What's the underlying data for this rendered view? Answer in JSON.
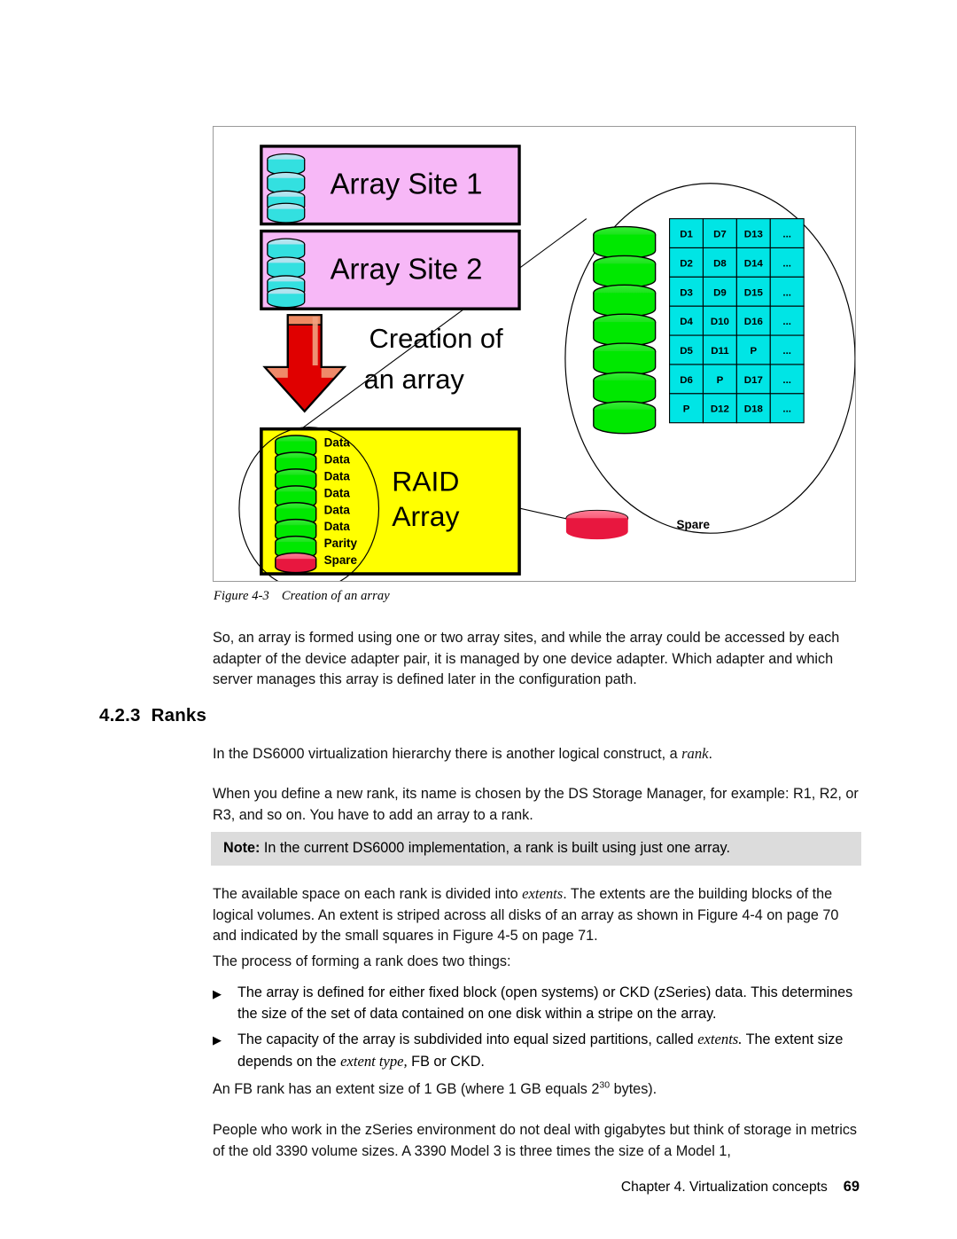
{
  "figure": {
    "caption_number": "Figure 4-3",
    "caption_text": "Creation of an array",
    "array_site_1": "Array Site 1",
    "array_site_2": "Array Site 2",
    "creation_label_line1": "Creation of",
    "creation_label_line2": "an array",
    "raid_label_line1": "RAID",
    "raid_label_line2": "Array",
    "disk_labels": [
      "Data",
      "Data",
      "Data",
      "Data",
      "Data",
      "Data",
      "Parity",
      "Spare"
    ],
    "spare_label": "Spare",
    "grid": {
      "rows": [
        [
          "D1",
          "D7",
          "D13",
          "..."
        ],
        [
          "D2",
          "D8",
          "D14",
          "..."
        ],
        [
          "D3",
          "D9",
          "D15",
          "..."
        ],
        [
          "D4",
          "D10",
          "D16",
          "..."
        ],
        [
          "D5",
          "D11",
          "P",
          "..."
        ],
        [
          "D6",
          "P",
          "D17",
          "..."
        ],
        [
          "P",
          "D12",
          "D18",
          "..."
        ]
      ]
    },
    "colors": {
      "array_site_fill": "#f7b8f7",
      "raid_fill": "#ffff00",
      "disk_cyan": "#33e0e0",
      "disk_green": "#00e800",
      "disk_red": "#e8173f",
      "grid_fill": "#00e5e5",
      "arrow_red": "#e00000",
      "frame_border": "#9a9a9a"
    }
  },
  "paragraphs": {
    "p1": "So, an array is formed using one or two array sites, and while the array could be accessed by each adapter of the device adapter pair, it is managed by one device adapter. Which adapter and which server manages this array is defined later in the configuration path.",
    "p2_pre": "In the DS6000 virtualization hierarchy there is another logical construct, a ",
    "p2_ital": "rank",
    "p2_post": ".",
    "p3": "When you define a new rank, its name is chosen by the DS Storage Manager, for example: R1, R2, or R3, and so on. You have to add an array to a rank.",
    "p4_pre": "The available space on each rank is divided into ",
    "p4_ital": "extents",
    "p4_post": ". The extents are the building blocks of the logical volumes. An extent is striped across all disks of an array as shown in Figure 4-4 on page 70 and indicated by the small squares in Figure 4-5 on page 71.",
    "p5": "The process of forming a rank does two things:",
    "p6_pre": "An FB rank has an extent size of 1 GB (where 1 GB equals 2",
    "p6_exp": "30",
    "p6_post": " bytes).",
    "p7": "People who work in the zSeries environment do not deal with gigabytes but think of storage in metrics of the old 3390 volume sizes. A 3390 Model 3 is three times the size of a Model 1,"
  },
  "heading": {
    "number": "4.2.3",
    "title": "Ranks"
  },
  "note": {
    "label": "Note:",
    "text": " In the current DS6000 implementation, a rank is built using just one array."
  },
  "bullets": [
    {
      "marker": "▶",
      "pre": "The array is defined for either fixed block (open systems) or CKD (zSeries) data. This determines the size of the set of data contained on one disk within a stripe on the array.",
      "ital": "",
      "post": ""
    },
    {
      "marker": "▶",
      "pre": "The capacity of the array is subdivided into equal sized partitions, called ",
      "ital": "extents.",
      "mid": " The extent size depends on the ",
      "ital2": "extent type,",
      "post": " FB or CKD."
    }
  ],
  "footer": {
    "chapter": "Chapter 4. Virtualization concepts",
    "page_number": "69"
  }
}
